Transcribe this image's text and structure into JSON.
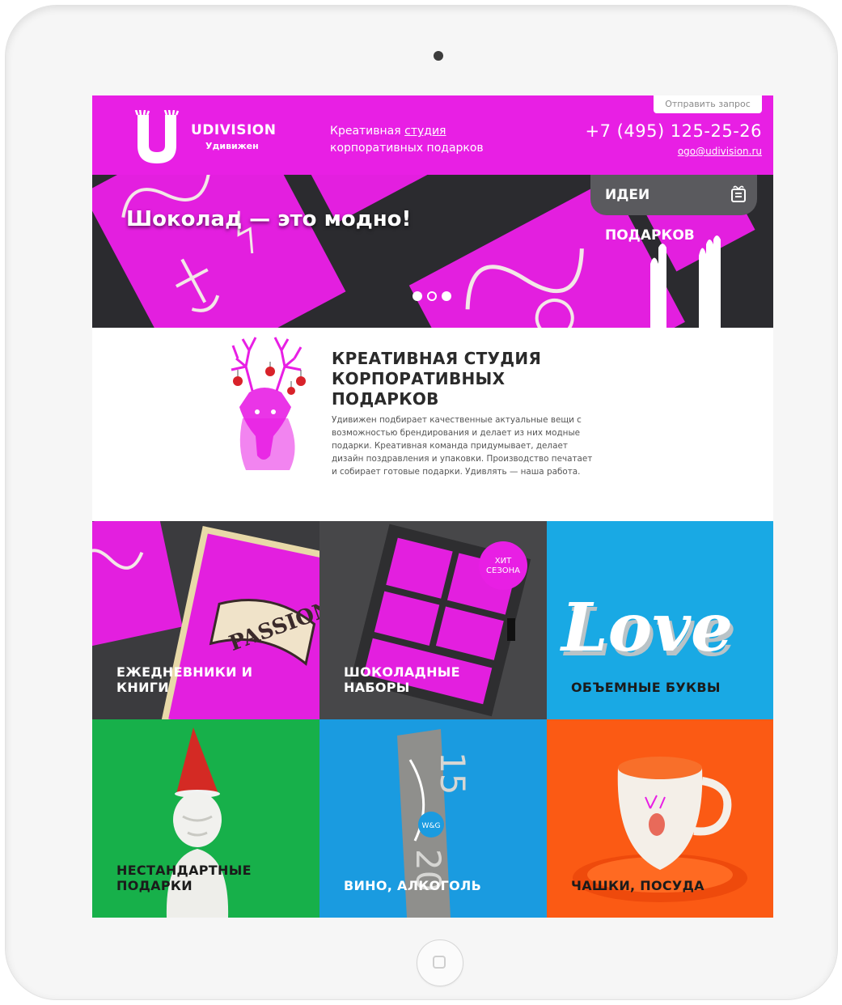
{
  "header": {
    "brand_name": "UDIVISION",
    "brand_sub": "Удивижен",
    "tagline_line1_prefix": "Креативная ",
    "tagline_line1_link": "студия",
    "tagline_line2": "корпоративных подарков",
    "request_button": "Отправить запрос",
    "phone": "+7 (495) 125-25-26",
    "email": "ogo@udivision.ru",
    "brand_color": "#e81fe4"
  },
  "hero": {
    "title": "Шоколад — это модно!",
    "ideas_tab": "ИДЕИ ПОДАРКОВ",
    "slide_dots": 3,
    "active_dot": 2
  },
  "about": {
    "title": "КРЕАТИВНАЯ СТУДИЯ КОРПОРАТИВНЫХ ПОДАРКОВ",
    "text": "Удивижен подбирает качественные актуальные вещи с возможностью брендирования и делает из них модные подарки. Креативная команда придумывает, делает дизайн поздравления и упаковки. Производство печатает и собирает готовые подарки. Удивлять — наша работа."
  },
  "categories": [
    {
      "label": "ЕЖЕДНЕВНИКИ И КНИГИ",
      "color": "#3a3a3a"
    },
    {
      "label": "ШОКОЛАДНЫЕ НАБОРЫ",
      "color": "#474747",
      "badge_line1": "ХИТ",
      "badge_line2": "СЕЗОНА"
    },
    {
      "label": "ОБЪЕМНЫЕ БУКВЫ",
      "color": "#19a9e4"
    },
    {
      "label": "НЕСТАНДАРТНЫЕ ПОДАРКИ",
      "color": "#17b04a"
    },
    {
      "label": "ВИНО, АЛКОГОЛЬ",
      "color": "#1a9be0"
    },
    {
      "label": "ЧАШКИ, ПОСУДА",
      "color": "#fb5a14"
    }
  ],
  "tile_art": {
    "love_text": "Love",
    "passion_text": "PASSION",
    "bottle_year_top": "20",
    "bottle_year_bottom": "15",
    "bottle_logo": "W&G"
  }
}
